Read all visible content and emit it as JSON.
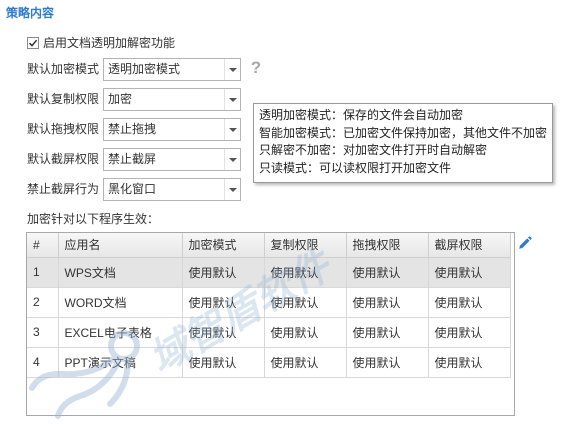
{
  "section_title": "策略内容",
  "enable_option": {
    "label": "启用文档透明加解密功能",
    "checked": true
  },
  "settings": [
    {
      "label": "默认加密模式",
      "value": "透明加密模式"
    },
    {
      "label": "默认复制权限",
      "value": "加密"
    },
    {
      "label": "默认拖拽权限",
      "value": "禁止拖拽"
    },
    {
      "label": "默认截屏权限",
      "value": "禁止截屏"
    },
    {
      "label": "禁止截屏行为",
      "value": "黑化窗口"
    }
  ],
  "help": {
    "glyph": "?",
    "icon": "question-icon"
  },
  "tooltip": {
    "lines": [
      "透明加密模式：保存的文件会自动加密",
      "智能加密模式：已加密文件保持加密，其他文件不加密",
      "只解密不加密：对加密文件打开时自动解密",
      "只读模式：可以读权限打开加密文件"
    ]
  },
  "programs_label": "加密针对以下程序生效：",
  "table": {
    "columns": [
      "#",
      "应用名",
      "加密模式",
      "复制权限",
      "拖拽权限",
      "截屏权限"
    ],
    "rows": [
      [
        "1",
        "WPS文档",
        "使用默认",
        "使用默认",
        "使用默认",
        "使用默认"
      ],
      [
        "2",
        "WORD文档",
        "使用默认",
        "使用默认",
        "使用默认",
        "使用默认"
      ],
      [
        "3",
        "EXCEL电子表格",
        "使用默认",
        "使用默认",
        "使用默认",
        "使用默认"
      ],
      [
        "4",
        "PPT演示文稿",
        "使用默认",
        "使用默认",
        "使用默认",
        "使用默认"
      ]
    ],
    "selected_row": 0
  },
  "icons": {
    "edit": "pencil-icon",
    "dropdown": "chevron-down-icon",
    "checkbox": "checkmark-icon",
    "watermark_logo": "octopus-logo"
  },
  "watermark": "域智盾软件",
  "colors": {
    "accent": "#2b7cd3",
    "header_bg": "#ececec",
    "selected_row_bg": "#e4e4e4",
    "help_icon": "#a8a8a8"
  }
}
